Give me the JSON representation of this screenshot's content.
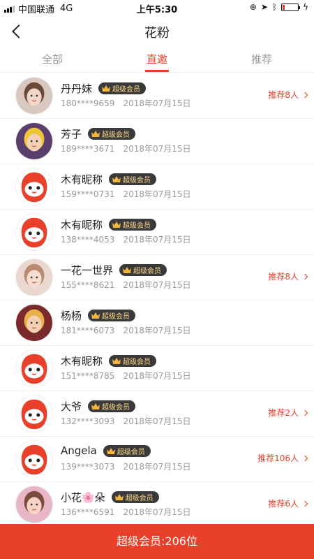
{
  "status_bar": {
    "carrier": "中国联通",
    "network": "4G",
    "time": "上午5:30",
    "battery_level": 0.15
  },
  "header": {
    "title": "花粉"
  },
  "tabs": [
    {
      "label": "全部",
      "active": false
    },
    {
      "label": "直邀",
      "active": true
    },
    {
      "label": "推荐",
      "active": false
    }
  ],
  "list": [
    {
      "name": "丹丹妹",
      "badge": "超级会员",
      "phone": "180****9659",
      "date": "2018年07月15日",
      "recommend": "推荐8人",
      "avatar": "photo-girl-1"
    },
    {
      "name": "芳子",
      "badge": "超级会员",
      "phone": "189****3671",
      "date": "2018年07月15日",
      "recommend": "",
      "avatar": "photo-child-1"
    },
    {
      "name": "木有昵称",
      "badge": "超级会员",
      "phone": "159****0731",
      "date": "2018年07月15日",
      "recommend": "",
      "avatar": "default-mascot"
    },
    {
      "name": "木有昵称",
      "badge": "超级会员",
      "phone": "138****4053",
      "date": "2018年07月15日",
      "recommend": "",
      "avatar": "default-mascot"
    },
    {
      "name": "一花一世界",
      "badge": "超级会员",
      "phone": "155****8621",
      "date": "2018年07月15日",
      "recommend": "推荐8人",
      "avatar": "photo-baby-1"
    },
    {
      "name": "杨杨",
      "badge": "超级会员",
      "phone": "181****6073",
      "date": "2018年07月15日",
      "recommend": "",
      "avatar": "photo-child-2"
    },
    {
      "name": "木有昵称",
      "badge": "超级会员",
      "phone": "151****8785",
      "date": "2018年07月15日",
      "recommend": "",
      "avatar": "default-mascot"
    },
    {
      "name": "大爷",
      "badge": "超级会员",
      "phone": "132****3093",
      "date": "2018年07月15日",
      "recommend": "推荐2人",
      "avatar": "default-mascot"
    },
    {
      "name": "Angela",
      "badge": "超级会员",
      "phone": "139****3073",
      "date": "2018年07月15日",
      "recommend": "推荐106人",
      "avatar": "default-mascot"
    },
    {
      "name": "小花🌸朵",
      "badge": "超级会员",
      "phone": "136****6591",
      "date": "2018年07月15日",
      "recommend": "推荐6人",
      "avatar": "photo-child-3"
    }
  ],
  "footer": {
    "label": "超级会员:206位"
  },
  "colors": {
    "accent": "#e8402a",
    "badge_bg": "#3a3a3a",
    "badge_text": "#ffd88a"
  }
}
